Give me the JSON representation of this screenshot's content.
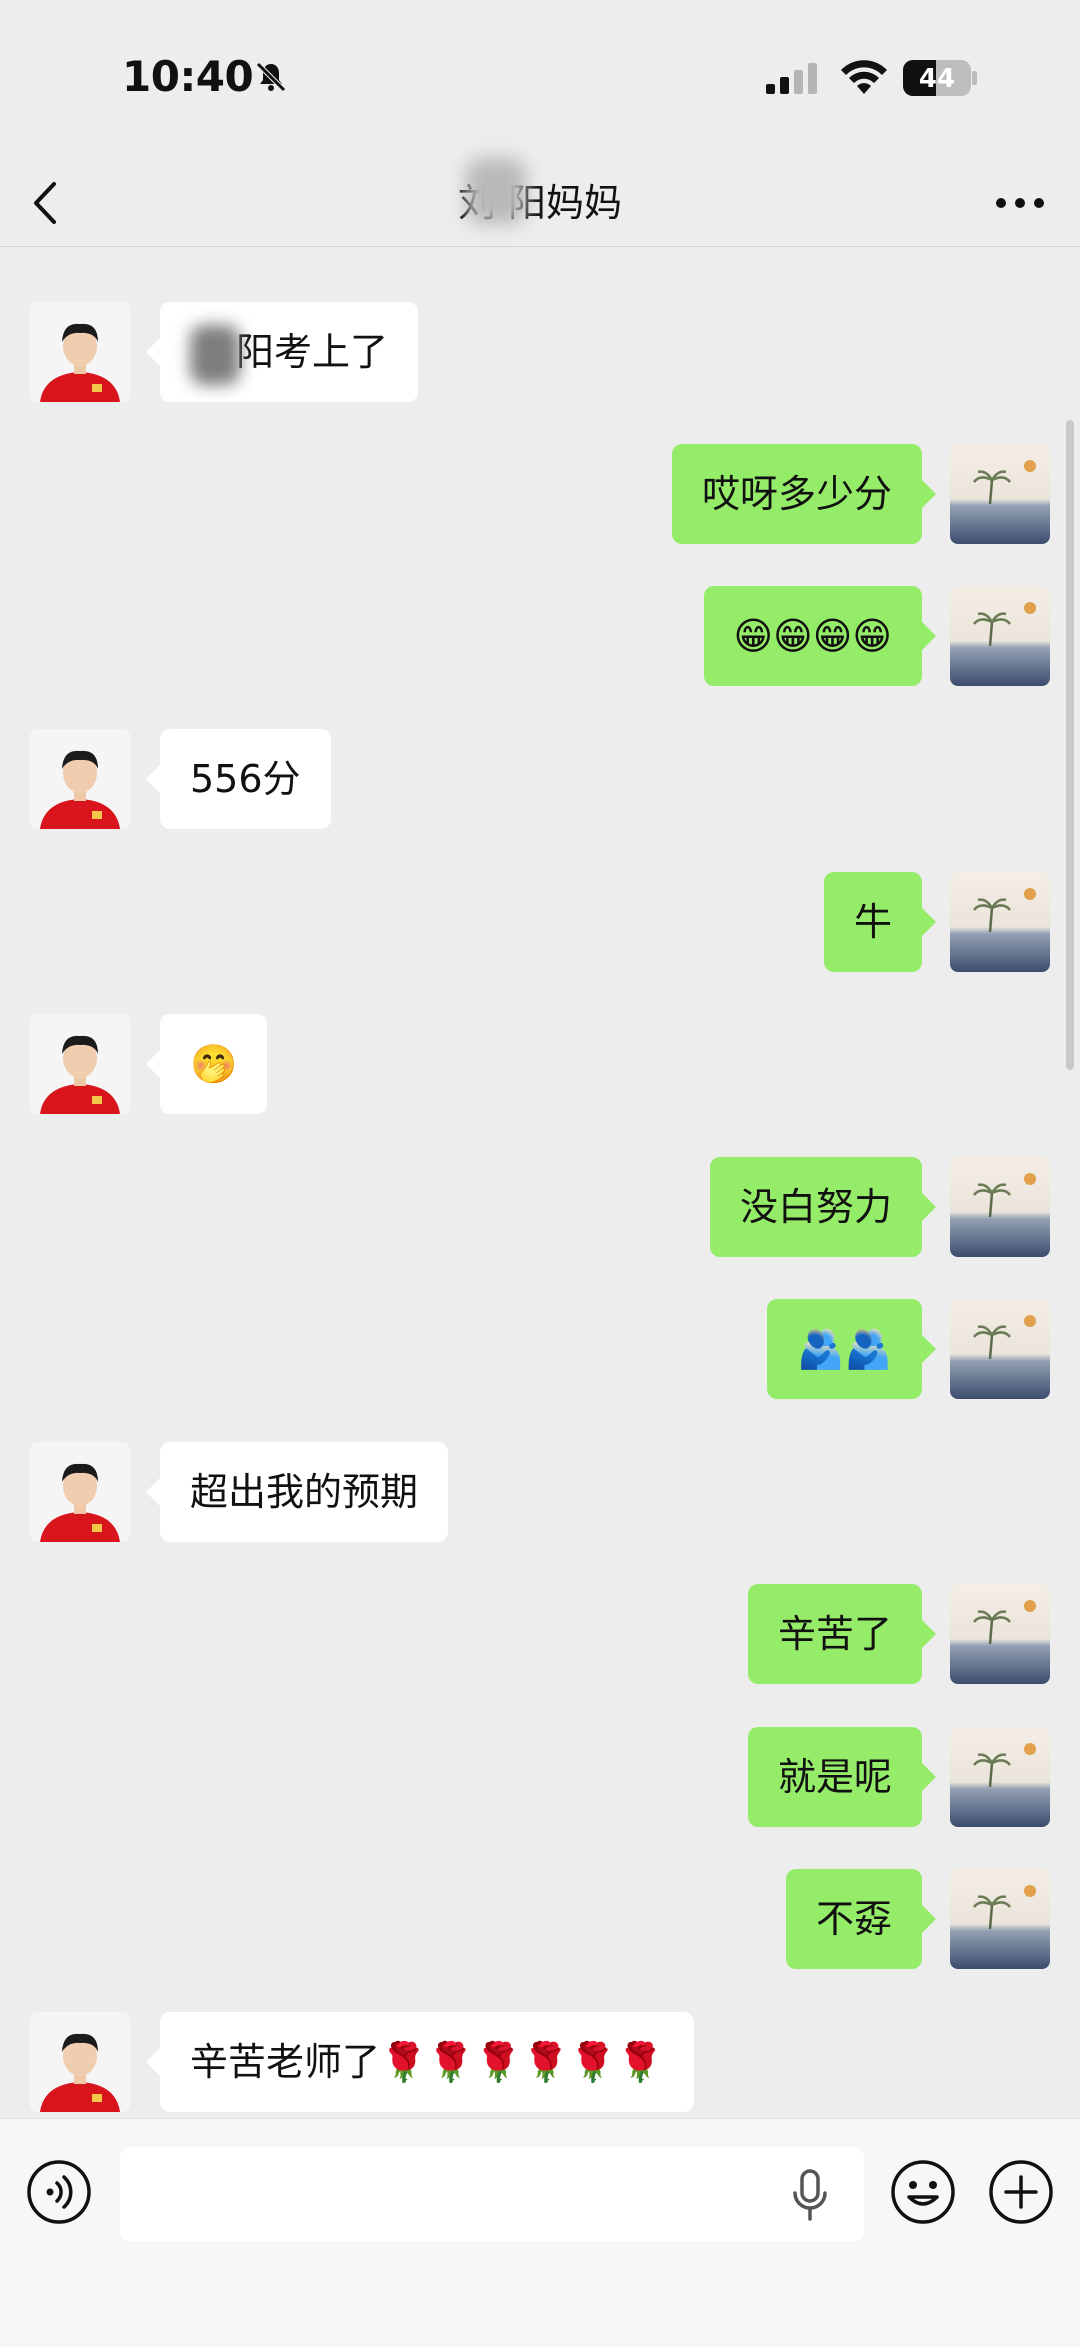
{
  "status_bar": {
    "time": "10:40",
    "battery": "44",
    "icons": [
      "bell-muted-icon",
      "signal-icon",
      "wifi-icon",
      "battery-icon"
    ]
  },
  "header": {
    "title": "刘 阳妈妈",
    "back_icon": "chevron-left-icon",
    "more_icon": "more-icon"
  },
  "messages": [
    {
      "side": "in",
      "text": "阳考上了"
    },
    {
      "side": "out",
      "text": "哎呀多少分"
    },
    {
      "side": "out",
      "text": "😁😁😁😁"
    },
    {
      "side": "in",
      "text": "556分"
    },
    {
      "side": "out",
      "text": "牛"
    },
    {
      "side": "in",
      "text": "🤭"
    },
    {
      "side": "out",
      "text": "没白努力"
    },
    {
      "side": "out",
      "text": "🫂🫂"
    },
    {
      "side": "in",
      "text": "超出我的预期"
    },
    {
      "side": "out",
      "text": "辛苦了"
    },
    {
      "side": "out",
      "text": "就是呢"
    },
    {
      "side": "out",
      "text": "不孬"
    },
    {
      "side": "in",
      "text": "辛苦老师了🌹🌹🌹🌹🌹🌹"
    }
  ],
  "input_bar": {
    "value": "",
    "icons": [
      "voice-icon",
      "mic-icon",
      "emoji-icon",
      "plus-icon"
    ]
  },
  "colors": {
    "background": "#ededed",
    "outgoing_bubble": "#95ec69",
    "incoming_bubble": "#ffffff"
  }
}
